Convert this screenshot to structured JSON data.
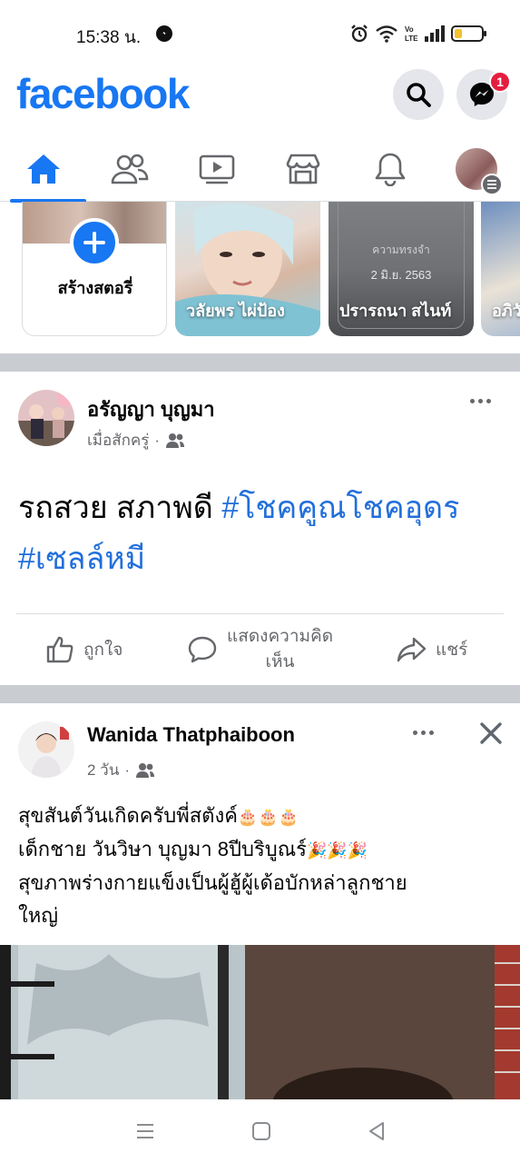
{
  "status_bar": {
    "time": "15:38 น.",
    "battery_level": 0.3,
    "battery_color": "#f2c230"
  },
  "header": {
    "logo": "facebook",
    "brand_color": "#1877f2",
    "search_icon": "search-icon",
    "messenger_icon": "messenger-icon",
    "messenger_badge": "1"
  },
  "tabs": [
    {
      "name": "home",
      "icon": "home-icon",
      "active": true
    },
    {
      "name": "friends",
      "icon": "friends-icon",
      "active": false
    },
    {
      "name": "watch",
      "icon": "video-icon",
      "active": false
    },
    {
      "name": "marketplace",
      "icon": "store-icon",
      "active": false
    },
    {
      "name": "notifications",
      "icon": "bell-icon",
      "active": false
    },
    {
      "name": "menu",
      "icon": "profile-menu-icon",
      "active": false
    }
  ],
  "stories": {
    "create_label": "สร้างสตอรี่",
    "items": [
      {
        "name": "วลัยพร ไผ่ป้อง"
      },
      {
        "name": "ปรารถนา สไนท์",
        "caption": "ความทรงจำ",
        "date": "2 มิ.ย. 2563"
      },
      {
        "name": "อภิวั"
      }
    ]
  },
  "posts": [
    {
      "author": "อรัญญา บุญมา",
      "time": "เมื่อสักครู่",
      "text": "รถสวย สภาพดี ",
      "hashtag1": "#โชคคูณโชคอุดร",
      "hashtag2": "#เซลล์หมี",
      "actions": {
        "like": "ถูกใจ",
        "comment_line1": "แสดงความคิด",
        "comment_line2": "เห็น",
        "share": "แชร์"
      }
    },
    {
      "author": "Wanida Thatphaiboon",
      "time": "2 วัน",
      "line1": "สุขสันต์วันเกิดครับพี่สตังค์",
      "line2": "เด็กชาย วันวิษา บุญมา  8ปีบริบูณร์",
      "line3": "สุขภาพร่างกายแข็งเป็นผู้ฮู้ผู้เด้อบักหล่าลูกชาย",
      "line4": "ใหญ่"
    }
  ],
  "navbar": {
    "recents_icon": "recents-icon",
    "home_icon": "home-square-icon",
    "back_icon": "back-icon"
  }
}
